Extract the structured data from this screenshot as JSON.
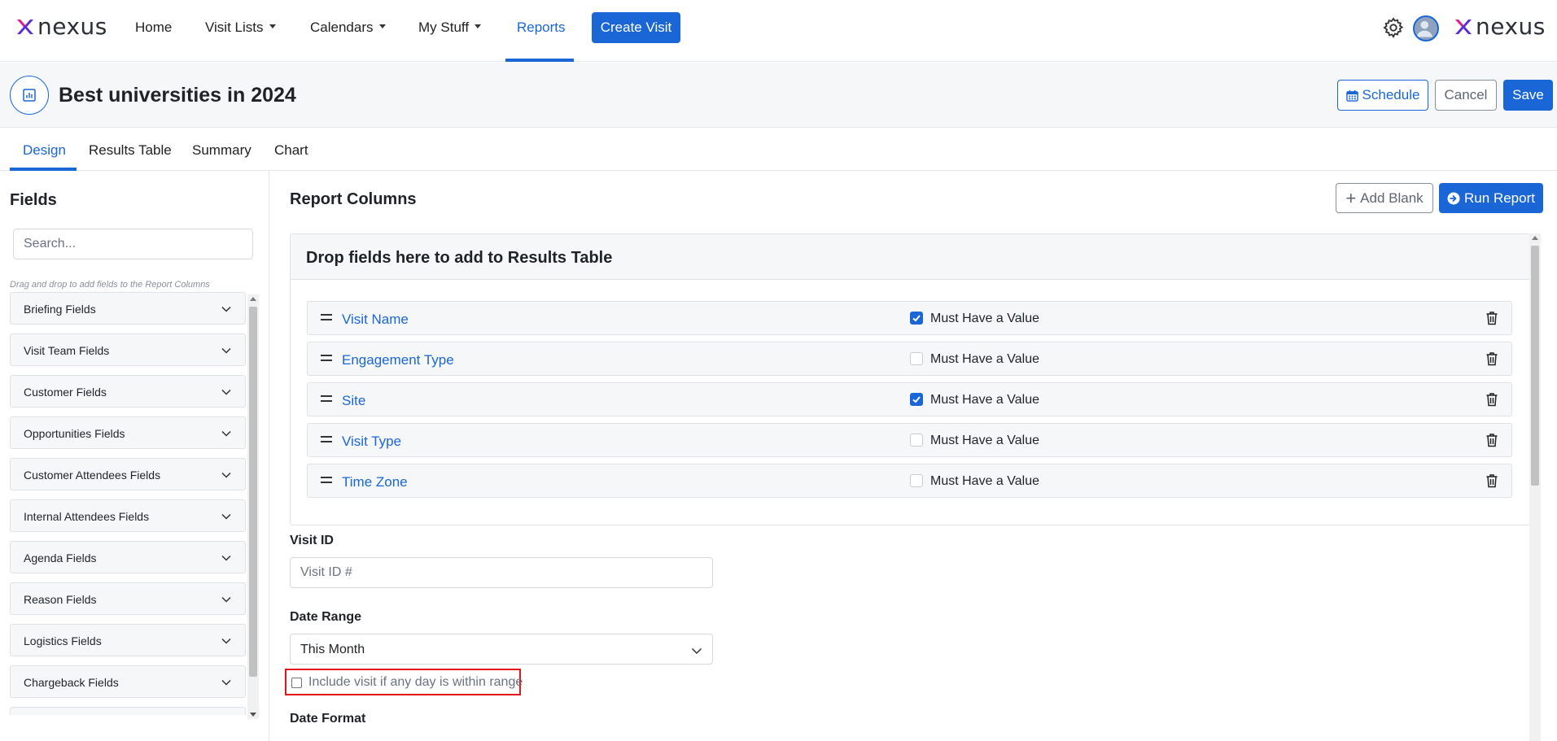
{
  "brand": {
    "name": "nexus",
    "accent": "#1a66d6",
    "logo_x_colors": [
      "#e0218a",
      "#5b2bd6"
    ]
  },
  "nav": {
    "home": "Home",
    "visit_lists": "Visit Lists",
    "calendars": "Calendars",
    "my_stuff": "My Stuff",
    "reports": "Reports",
    "create_visit": "Create Visit",
    "settings_icon": "gear-icon",
    "avatar_icon": "user-avatar"
  },
  "header": {
    "title": "Best universities in 2024",
    "icon": "report-chart-icon",
    "schedule": "Schedule",
    "cancel": "Cancel",
    "save": "Save"
  },
  "tabs": {
    "design": "Design",
    "results_table": "Results Table",
    "summary": "Summary",
    "chart": "Chart",
    "active": "design"
  },
  "fields_panel": {
    "title": "Fields",
    "search_placeholder": "Search...",
    "hint": "Drag and drop to add fields to the Report Columns",
    "groups": [
      "Briefing Fields",
      "Visit Team Fields",
      "Customer Fields",
      "Opportunities Fields",
      "Customer Attendees Fields",
      "Internal Attendees Fields",
      "Agenda Fields",
      "Reason Fields",
      "Logistics Fields",
      "Chargeback Fields",
      ""
    ]
  },
  "report": {
    "title": "Report Columns",
    "add_blank": "Add Blank",
    "run_report": "Run Report",
    "drop_title": "Drop fields here to add to Results Table",
    "must_label": "Must Have a Value",
    "columns": [
      {
        "name": "Visit Name",
        "must": true
      },
      {
        "name": "Engagement Type",
        "must": false
      },
      {
        "name": "Site",
        "must": true
      },
      {
        "name": "Visit Type",
        "must": false
      },
      {
        "name": "Time Zone",
        "must": false
      }
    ]
  },
  "filters": {
    "visit_id_label": "Visit ID",
    "visit_id_placeholder": "Visit ID #",
    "date_range_label": "Date Range",
    "date_range_value": "This Month",
    "include_label": "Include visit if any day is within range",
    "include_checked": false,
    "date_format_label": "Date Format"
  }
}
